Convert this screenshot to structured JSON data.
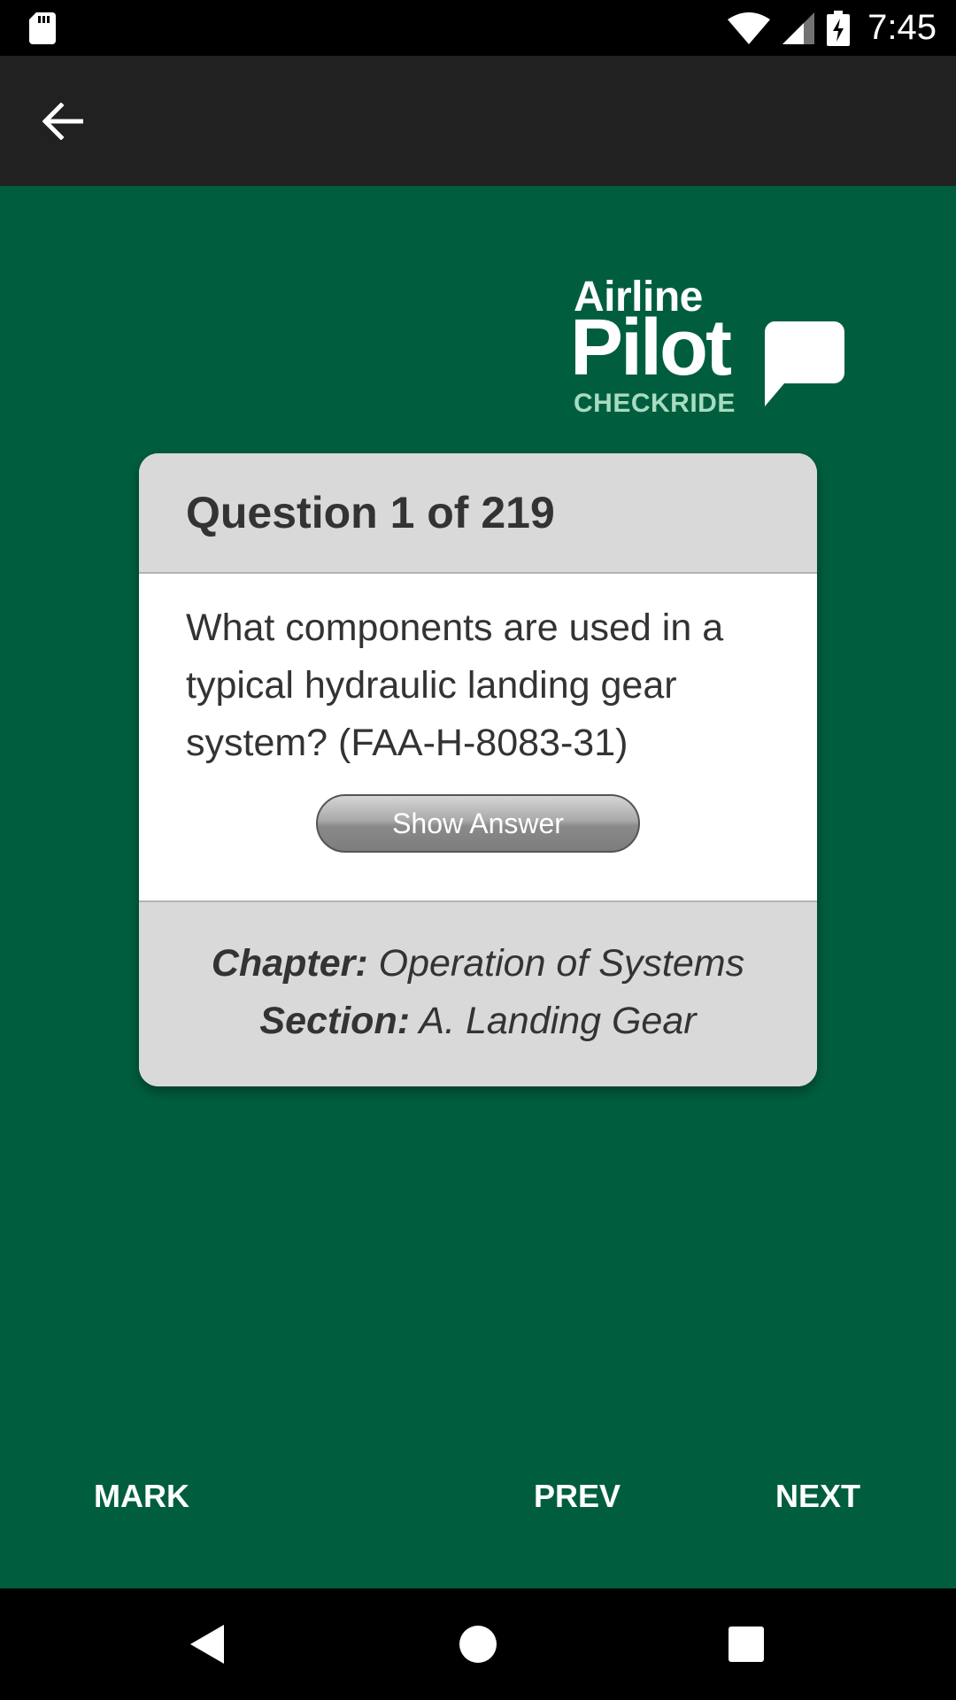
{
  "status_bar": {
    "time": "7:45",
    "icons": [
      "sd-card-icon",
      "wifi-icon",
      "signal-icon",
      "battery-charging-icon"
    ]
  },
  "app_bar": {
    "back_icon": "arrow-left-icon"
  },
  "logo": {
    "line1": "Airline",
    "line2": "Pilot",
    "line3": "CHECKRIDE",
    "bubble_icon": "speech-bubble-icon",
    "accent_color": "#a7dcc0"
  },
  "card": {
    "title": "Question 1 of 219",
    "question": "What components are used in a typical hydraulic landing gear system? (FAA-H-8083-31)",
    "show_answer_label": "Show Answer",
    "chapter_label": "Chapter:",
    "chapter_value": "Operation of Systems",
    "section_label": "Section:",
    "section_value": "A. Landing Gear"
  },
  "actions": {
    "mark": "MARK",
    "prev": "PREV",
    "next": "NEXT"
  },
  "nav_bar": {
    "icons": [
      "nav-back-icon",
      "nav-home-icon",
      "nav-recents-icon"
    ]
  },
  "colors": {
    "background": "#005e3f",
    "app_bar": "#212121",
    "card_header": "#d9d9d9",
    "text": "#333333"
  }
}
